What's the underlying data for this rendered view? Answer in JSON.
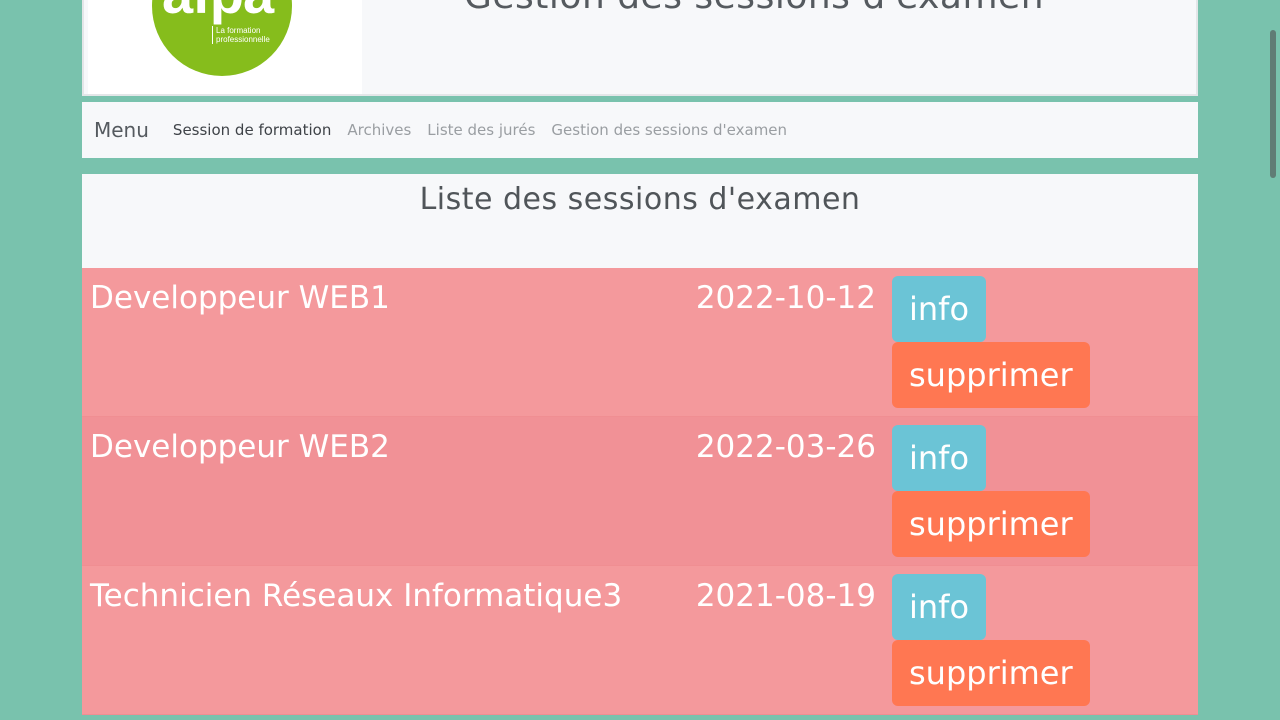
{
  "header": {
    "logo_text": "afpa",
    "logo_tagline": "La formation professionnelle",
    "site_title": "Gestion des sessions d'examen"
  },
  "nav": {
    "brand": "Menu",
    "links": [
      {
        "label": "Session de formation",
        "active": true
      },
      {
        "label": "Archives",
        "active": false
      },
      {
        "label": "Liste des jurés",
        "active": false
      },
      {
        "label": "Gestion des sessions d'examen",
        "active": false
      }
    ]
  },
  "main": {
    "title": "Liste des sessions d'examen",
    "sessions": [
      {
        "name": "Developpeur WEB1",
        "date": "2022-10-12",
        "info_label": "info",
        "delete_label": "supprimer"
      },
      {
        "name": "Developpeur WEB2",
        "date": "2022-03-26",
        "info_label": "info",
        "delete_label": "supprimer"
      },
      {
        "name": "Technicien Réseaux Informatique3",
        "date": "2021-08-19",
        "info_label": "info",
        "delete_label": "supprimer"
      }
    ]
  },
  "colors": {
    "background": "#79c2ad",
    "row": "#f4999c",
    "info_button": "#6bc4d6",
    "delete_button": "#ff7752",
    "logo": "#86bd1c"
  }
}
